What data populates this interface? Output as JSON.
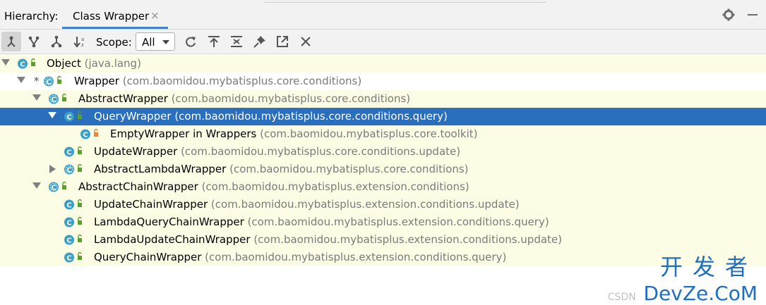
{
  "header": {
    "label": "Hierarchy:",
    "tab_title": "Class Wrapper",
    "tab_close": "×"
  },
  "toolbar": {
    "scope_label": "Scope:",
    "scope_value": "All"
  },
  "tree": [
    {
      "name": "Object",
      "pkg": "(java.lang)",
      "expanded": true
    },
    {
      "name": "Wrapper",
      "pkg": "(com.baomidou.mybatisplus.core.conditions)",
      "expanded": true,
      "marker": "*"
    },
    {
      "name": "AbstractWrapper",
      "pkg": "(com.baomidou.mybatisplus.core.conditions)",
      "expanded": true
    },
    {
      "name": "QueryWrapper",
      "pkg": "(com.baomidou.mybatisplus.core.conditions.query)",
      "expanded": true,
      "selected": true
    },
    {
      "name": "EmptyWrapper in Wrappers",
      "pkg": "(com.baomidou.mybatisplus.core.toolkit)"
    },
    {
      "name": "UpdateWrapper",
      "pkg": "(com.baomidou.mybatisplus.core.conditions.update)"
    },
    {
      "name": "AbstractLambdaWrapper",
      "pkg": "(com.baomidou.mybatisplus.core.conditions)",
      "expanded": false
    },
    {
      "name": "AbstractChainWrapper",
      "pkg": "(com.baomidou.mybatisplus.extension.conditions)",
      "expanded": true
    },
    {
      "name": "UpdateChainWrapper",
      "pkg": "(com.baomidou.mybatisplus.extension.conditions.update)"
    },
    {
      "name": "LambdaQueryChainWrapper",
      "pkg": "(com.baomidou.mybatisplus.extension.conditions.query)"
    },
    {
      "name": "LambdaUpdateChainWrapper",
      "pkg": "(com.baomidou.mybatisplus.extension.conditions.update)"
    },
    {
      "name": "QueryChainWrapper",
      "pkg": "(com.baomidou.mybatisplus.extension.conditions.query)"
    }
  ],
  "watermark": {
    "cn": "开发者",
    "csdn": "CSDN",
    "en": "DevZe.CoM"
  },
  "colors": {
    "selection": "#2a6fbd",
    "row_bg": "#fdfde6",
    "class_icon": "#3aa0c8",
    "public_badge": "#5aa02c",
    "private_badge": "#e8843c",
    "watermark": "#1e6fbf"
  }
}
